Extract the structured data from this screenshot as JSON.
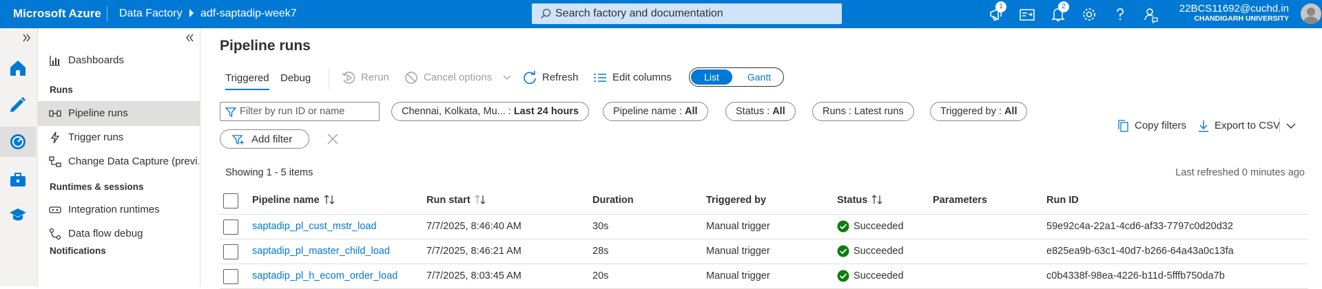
{
  "topbar": {
    "brand": "Microsoft Azure",
    "service": "Data Factory",
    "factory": "adf-saptadip-week7",
    "search_placeholder": "Search factory and documentation",
    "updates_badge": "1",
    "notifications_badge": "2",
    "user_name": "22BCS11692@cuchd.in",
    "user_org": "CHANDIGARH UNIVERSITY"
  },
  "nav": {
    "dashboards": "Dashboards",
    "runs_section": "Runs",
    "pipeline_runs": "Pipeline runs",
    "trigger_runs": "Trigger runs",
    "cdc": "Change Data Capture (previ...",
    "runtimes_section": "Runtimes & sessions",
    "integration_runtimes": "Integration runtimes",
    "data_flow_debug": "Data flow debug",
    "notifications_section": "Notifications"
  },
  "main": {
    "title": "Pipeline runs",
    "tabs": [
      {
        "label": "Triggered"
      },
      {
        "label": "Debug"
      }
    ],
    "toolbar": {
      "rerun": "Rerun",
      "cancel": "Cancel options",
      "refresh": "Refresh",
      "edit_columns": "Edit columns",
      "view_list": "List",
      "view_gantt": "Gantt"
    },
    "filters": {
      "run_id_placeholder": "Filter by run ID or name",
      "timezone_label": "Chennai, Kolkata, Mu...",
      "timezone_value": "Last 24 hours",
      "pipeline_name_label": "Pipeline name : ",
      "pipeline_name_value": "All",
      "status_label": "Status : ",
      "status_value": "All",
      "runs_label": "Runs : ",
      "runs_value": "Latest runs",
      "triggered_by_label": "Triggered by : ",
      "triggered_by_value": "All",
      "add_filter": "Add filter",
      "copy_filters": "Copy filters",
      "export_csv": "Export to CSV"
    },
    "showing": "Showing 1 - 5 items",
    "last_refreshed": "Last refreshed 0 minutes ago",
    "columns": {
      "pipeline_name": "Pipeline name",
      "run_start": "Run start",
      "duration": "Duration",
      "triggered_by": "Triggered by",
      "status": "Status",
      "parameters": "Parameters",
      "run_id": "Run ID"
    },
    "rows": [
      {
        "pipeline": "saptadip_pl_cust_mstr_load",
        "run_start": "7/7/2025, 8:46:40 AM",
        "duration": "30s",
        "triggered_by": "Manual trigger",
        "status": "Succeeded",
        "run_id": "59e92c4a-22a1-4cd6-af33-7797c0d20d32"
      },
      {
        "pipeline": "saptadip_pl_master_child_load",
        "run_start": "7/7/2025, 8:46:21 AM",
        "duration": "28s",
        "triggered_by": "Manual trigger",
        "status": "Succeeded",
        "run_id": "e825ea9b-63c1-40d7-b266-64a43a0c13fa"
      },
      {
        "pipeline": "saptadip_pl_h_ecom_order_load",
        "run_start": "7/7/2025, 8:03:45 AM",
        "duration": "20s",
        "triggered_by": "Manual trigger",
        "status": "Succeeded",
        "run_id": "c0b4338f-98ea-4226-b11d-5fffb750da7b"
      }
    ],
    "status_color": "#107c10"
  }
}
